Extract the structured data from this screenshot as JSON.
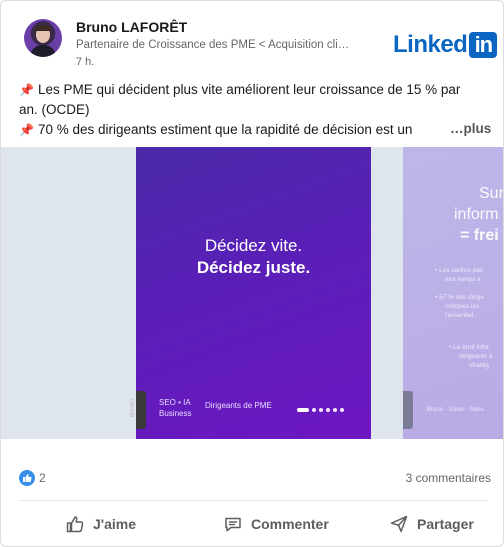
{
  "post": {
    "author": {
      "name": "Bruno LAFORÊT",
      "headline": "Partenaire de Croissance des PME < Acquisition cli…",
      "time": "7 h."
    },
    "brand": {
      "word": "Linked",
      "in": "in"
    },
    "text": {
      "line1": "Les PME qui décident plus vite améliorent leur croissance de 15 % par",
      "line2": "an. (OCDE)",
      "line3": "70 % des dirigeants estiment que la rapidité de décision est un",
      "more": "…plus"
    },
    "carousel": {
      "current": {
        "title_line1": "Décidez vite.",
        "title_line2": "Décidez juste.",
        "tag_left": "SEO • IA Business",
        "tag_right": "Dirigeants de PME",
        "side_tab": "BRUNO",
        "slide_index": 1,
        "slide_count": 6
      },
      "next": {
        "h1": "Sur",
        "h2": "inform",
        "h3": "= frei",
        "b1a": "• Les cadres pas",
        "b1b": "leur temps à",
        "b2a": "• 57 % des dirige",
        "b2b": "critiques les",
        "b2c": "l'essentiel.",
        "b3a": "• Le bruit infor",
        "b3b": "dirigeants à",
        "b3c": "stratég",
        "foot": "Bruno · Vision · Sens"
      }
    },
    "social": {
      "likes": "2",
      "comments": "3 commentaires"
    },
    "actions": {
      "like": "J'aime",
      "comment": "Commenter",
      "share": "Partager"
    }
  },
  "colors": {
    "linkedin_blue": "#0a66c2",
    "slide_purple": "#5a1fb8",
    "like_blue": "#378fe9"
  }
}
